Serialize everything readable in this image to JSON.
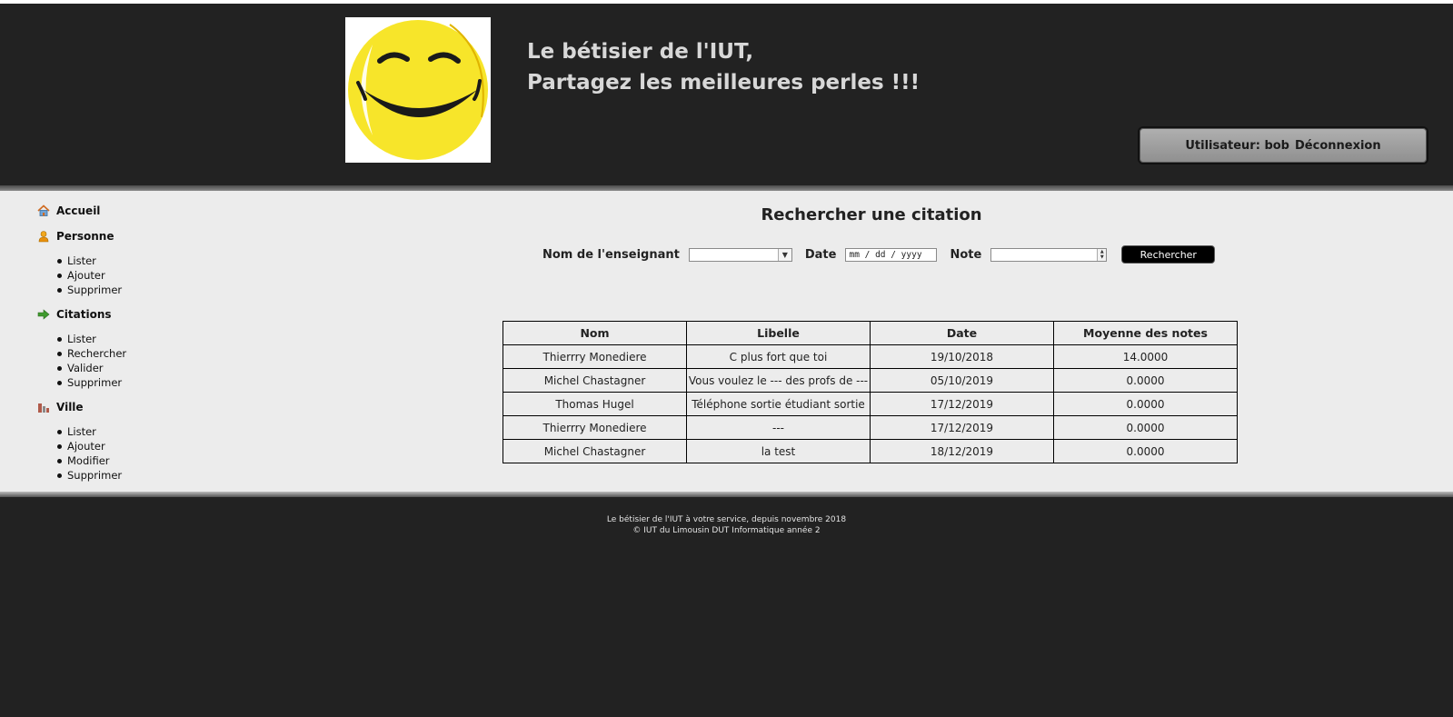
{
  "header": {
    "title_line1": "Le bétisier de l'IUT,",
    "title_line2": "Partagez les meilleures perles !!!",
    "user_label": "Utilisateur: bob",
    "logout_label": "Déconnexion",
    "logo_icon": "smiley-icon"
  },
  "sidebar": {
    "sections": [
      {
        "label": "Accueil",
        "icon": "home-icon",
        "items": []
      },
      {
        "label": "Personne",
        "icon": "person-icon",
        "items": [
          "Lister",
          "Ajouter",
          "Supprimer"
        ]
      },
      {
        "label": "Citations",
        "icon": "arrow-right-icon",
        "items": [
          "Lister",
          "Rechercher",
          "Valider",
          "Supprimer"
        ]
      },
      {
        "label": "Ville",
        "icon": "city-icon",
        "items": [
          "Lister",
          "Ajouter",
          "Modifier",
          "Supprimer"
        ]
      }
    ]
  },
  "main": {
    "title": "Rechercher une citation",
    "form": {
      "teacher_label": "Nom de l'enseignant",
      "teacher_value": "",
      "date_label": "Date",
      "date_placeholder": "mm / dd / yyyy",
      "note_label": "Note",
      "note_value": "",
      "submit_label": "Rechercher"
    },
    "table": {
      "headers": [
        "Nom",
        "Libelle",
        "Date",
        "Moyenne des notes"
      ],
      "rows": [
        [
          "Thierrry Monediere",
          "C plus fort que toi",
          "19/10/2018",
          "14.0000"
        ],
        [
          "Michel Chastagner",
          "Vous voulez le --- des profs de ---",
          "05/10/2019",
          "0.0000"
        ],
        [
          "Thomas Hugel",
          "Téléphone sortie étudiant sortie",
          "17/12/2019",
          "0.0000"
        ],
        [
          "Thierrry Monediere",
          "---",
          "17/12/2019",
          "0.0000"
        ],
        [
          "Michel Chastagner",
          "la test",
          "18/12/2019",
          "0.0000"
        ]
      ]
    }
  },
  "footer": {
    "line1": "Le bétisier de l'IUT à votre service, depuis novembre 2018",
    "line2": "© IUT du Limousin DUT Informatique année 2"
  },
  "colors": {
    "background": "#222222",
    "content_bg": "#ececec",
    "logo_yellow": "#f7e52a"
  }
}
